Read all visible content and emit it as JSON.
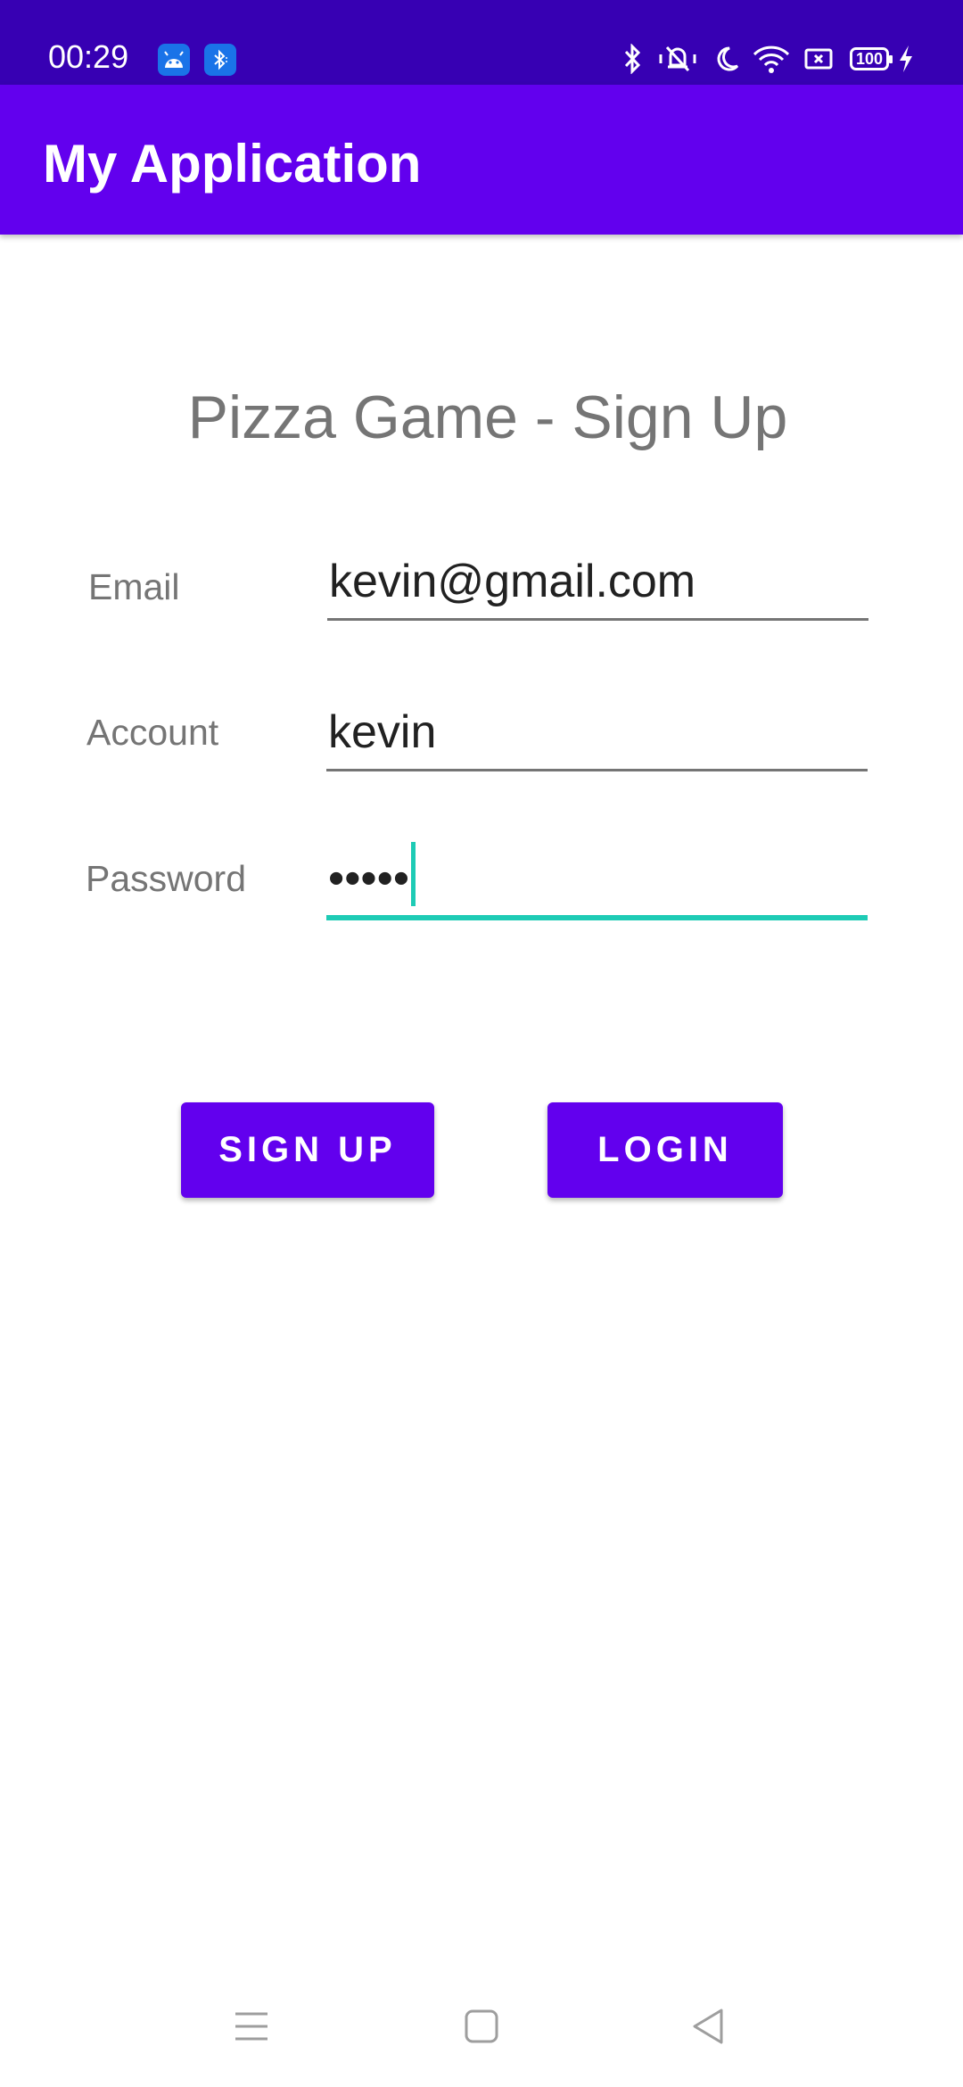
{
  "status_bar": {
    "time": "00:29",
    "battery_level": "100",
    "notification_icons": [
      "android-icon",
      "bluetooth-file-icon"
    ],
    "system_icons": [
      "bluetooth-icon",
      "vibrate-off-icon",
      "moon-icon",
      "wifi-icon",
      "screen-record-icon",
      "battery-icon",
      "charging-icon"
    ]
  },
  "app_bar": {
    "title": "My Application"
  },
  "form": {
    "title": "Pizza Game - Sign Up",
    "email": {
      "label": "Email",
      "value": "kevin@gmail.com"
    },
    "account": {
      "label": "Account",
      "value": "kevin"
    },
    "password": {
      "label": "Password",
      "value": "•••••"
    }
  },
  "buttons": {
    "sign_up": "SIGN UP",
    "login": "LOGIN"
  },
  "nav_bar": {
    "icons": [
      "menu-icon",
      "home-icon",
      "back-icon"
    ]
  },
  "colors": {
    "status_bar": "#3700B3",
    "primary": "#6200EE",
    "accent": "#1ECBB5",
    "label_gray": "#757575",
    "text_dark": "#212121"
  }
}
